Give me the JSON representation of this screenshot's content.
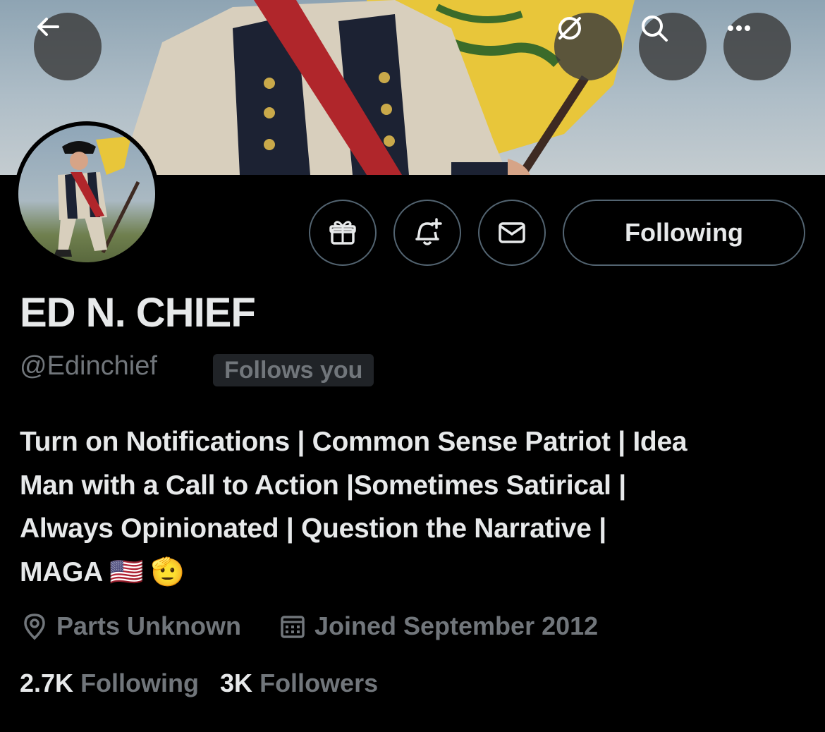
{
  "header": {
    "back_icon": "arrow-left-icon",
    "grok_icon": "grok-icon",
    "search_icon": "search-icon",
    "more_icon": "more-horizontal-icon"
  },
  "actions": {
    "gift_icon": "gift-icon",
    "notify_icon": "bell-plus-icon",
    "message_icon": "envelope-icon",
    "follow_label": "Following"
  },
  "profile": {
    "name": "ED N. CHIEF",
    "handle": "@Edinchief",
    "follows_you": "Follows you",
    "bio_lines": [
      "Turn on Notifications | Common Sense Patriot | Idea",
      "Man with a Call to Action |Sometimes Satirical |",
      "Always Opinionated | Question the Narrative |",
      "MAGA 🇺🇸 🫡"
    ],
    "location": "Parts Unknown",
    "joined": "Joined September 2012"
  },
  "stats": {
    "following_count": "2.7K",
    "following_label": "Following",
    "followers_count": "3K",
    "followers_label": "Followers"
  },
  "colors": {
    "background": "#000000",
    "text": "#e7e9ea",
    "muted": "#71767b",
    "border": "#536471"
  }
}
